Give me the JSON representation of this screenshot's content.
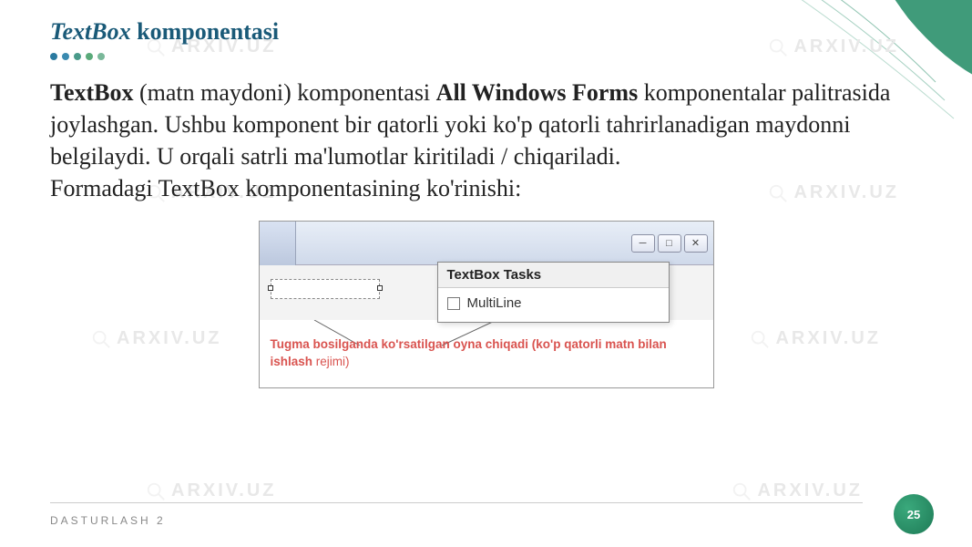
{
  "header": {
    "title_em": "TextBox",
    "title_rest": " komponentasi"
  },
  "paragraph": {
    "p1_b1": "TextBox",
    "p1_t1": " (matn maydoni) komponentasi ",
    "p1_b2": "All Windows Forms",
    "p1_t2": " komponentalar palitrasida joylashgan. Ushbu komponent bir qatorli yoki ko'p qatorli tahrirlanadigan maydonni belgilaydi. U orqali satrli ma'lumotlar kiritiladi / chiqariladi.",
    "p2": "Formadagi TextBox komponentasining ko'rinishi:"
  },
  "figure": {
    "window_buttons": {
      "min": "─",
      "max": "□",
      "close": "✕"
    },
    "popup_title": "TextBox Tasks",
    "popup_option": "MultiLine",
    "caption_b": "Tugma bosilganda ko'rsatilgan oyna chiqadi (ko'p qatorli matn bilan ishlash",
    "caption_t": " rejimi)"
  },
  "footer": {
    "label": "DASTURLASH 2",
    "page": "25"
  },
  "watermark": "ARXIV.UZ"
}
